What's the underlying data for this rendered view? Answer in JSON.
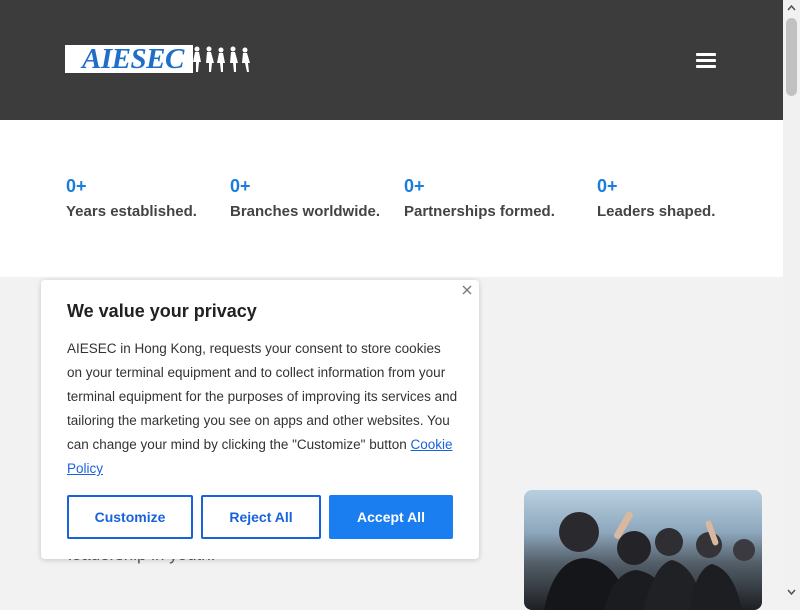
{
  "header": {
    "logo_text": "AIESEC",
    "menu_icon": "hamburger-menu-icon"
  },
  "stats": [
    {
      "value": "0+",
      "label": "Years established."
    },
    {
      "value": "0+",
      "label": "Branches worldwide."
    },
    {
      "value": "0+",
      "label": "Partnerships formed."
    },
    {
      "value": "0+",
      "label": "Leaders shaped."
    }
  ],
  "background": {
    "partial_text": "leadership in youth."
  },
  "cookie_banner": {
    "title": "We value your privacy",
    "body": "AIESEC in Hong Kong, requests your consent to store cookies on your terminal equipment and to collect information from your terminal equipment for the purposes of improving its services and tailoring the marketing you see on apps and other websites. You can change your mind by clicking the \"Customize\" button",
    "link_text": "Cookie Policy",
    "buttons": {
      "customize": "Customize",
      "reject": "Reject All",
      "accept": "Accept All"
    },
    "close_icon": "close-icon"
  },
  "colors": {
    "header_bg": "#3d3c3c",
    "accent_blue": "#1a7ddb",
    "button_blue": "#1863dc"
  }
}
